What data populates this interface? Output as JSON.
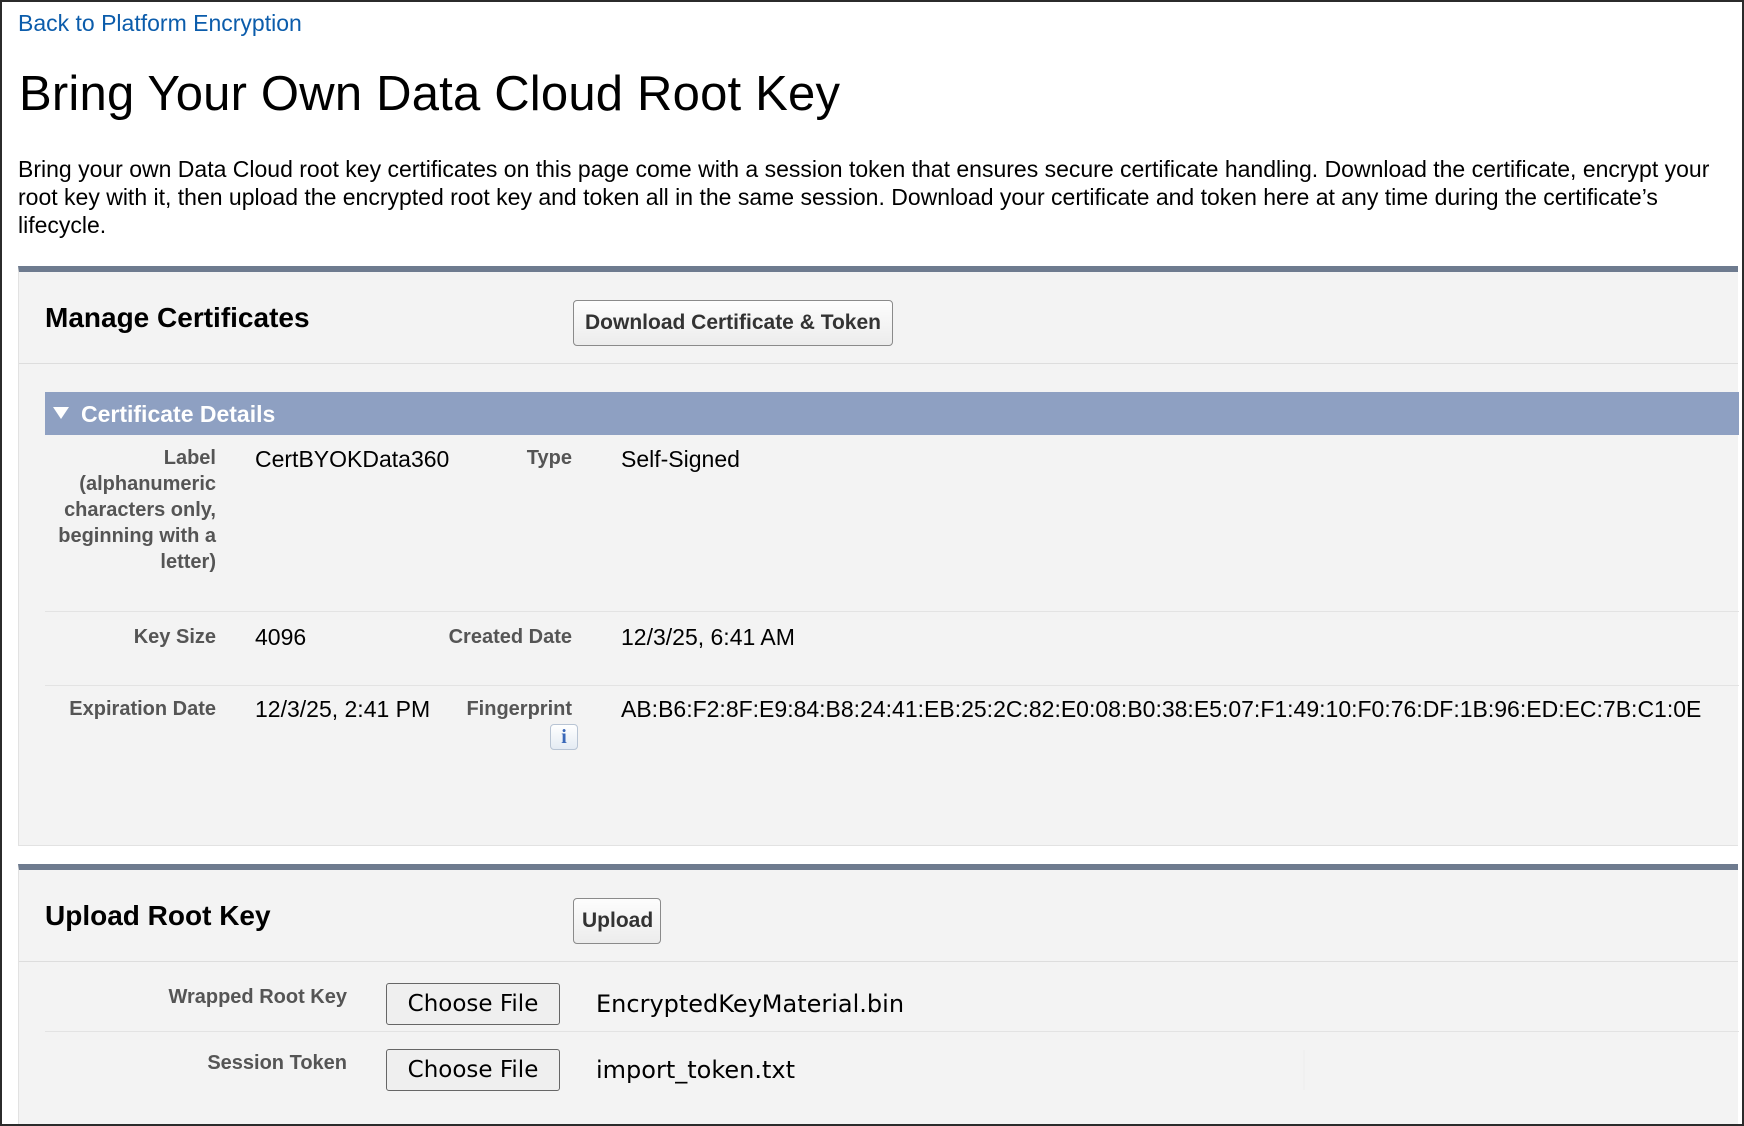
{
  "nav": {
    "back_link": "Back to Platform Encryption"
  },
  "page": {
    "title": "Bring Your Own Data Cloud Root Key",
    "intro": "Bring your own Data Cloud root key certificates on this page come with a session token that ensures secure certificate handling. Download the certificate, encrypt your root key with it, then upload the encrypted root key and token all in the same session. Download your certificate and token here at any time during the certificate’s lifecycle."
  },
  "manage_certificates": {
    "title": "Manage Certificates",
    "download_button": "Download Certificate & Token",
    "section_title": "Certificate Details",
    "fields": {
      "label_label": "Label (alphanumeric characters only, beginning with a letter)",
      "label_value": "CertBYOKData360",
      "type_label": "Type",
      "type_value": "Self-Signed",
      "key_size_label": "Key Size",
      "key_size_value": "4096",
      "created_date_label": "Created Date",
      "created_date_value": "12/3/25, 6:41 AM",
      "expiration_date_label": "Expiration Date",
      "expiration_date_value": "12/3/25, 2:41 PM",
      "fingerprint_label": "Fingerprint",
      "fingerprint_value": "AB:B6:F2:8F:E9:84:B8:24:41:EB:25:2C:82:E0:08:B0:38:E5:07:F1:49:10:F0:76:DF:1B:96:ED:EC:7B:C1:0E",
      "info_icon_glyph": "i"
    }
  },
  "upload_root_key": {
    "title": "Upload Root Key",
    "upload_button": "Upload",
    "wrapped_root_key_label": "Wrapped Root Key",
    "wrapped_root_key_button": "Choose File",
    "wrapped_root_key_file": "EncryptedKeyMaterial.bin",
    "session_token_label": "Session Token",
    "session_token_button": "Choose File",
    "session_token_file": "import_token.txt"
  },
  "colors": {
    "link": "#0b5cab",
    "section_bar": "#8ea0c2",
    "panel_top_border": "#6e7b8f"
  },
  "icons": {
    "section_toggle": "triangle-down-icon",
    "fingerprint_help": "info-icon"
  }
}
